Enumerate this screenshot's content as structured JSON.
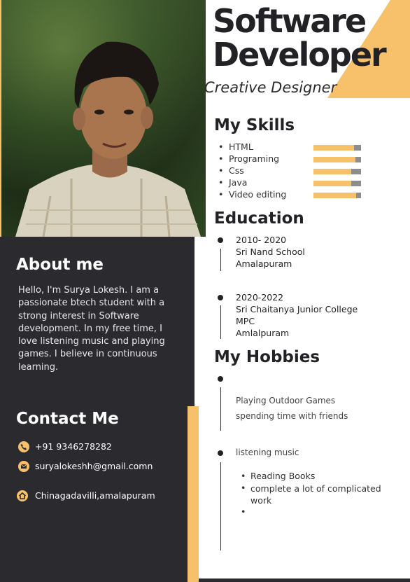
{
  "header": {
    "title_line1": "Software",
    "title_line2": "Developer",
    "subtitle": "Creative Designer"
  },
  "skills": {
    "heading": "My Skills",
    "items": [
      {
        "label": "HTML",
        "level": 0.85
      },
      {
        "label": "Programing",
        "level": 0.88
      },
      {
        "label": "Css",
        "level": 0.8
      },
      {
        "label": "Java",
        "level": 0.8
      },
      {
        "label": "Video editing",
        "level": 0.9
      }
    ]
  },
  "education": {
    "heading": "Education",
    "entries": [
      {
        "years": "2010- 2020",
        "school": "Sri Nand School",
        "extra": "",
        "place": "Amalapuram"
      },
      {
        "years": "2020-2022",
        "school": "Sri Chaitanya Junior College",
        "extra": "MPC",
        "place": "Amlalpuram"
      }
    ]
  },
  "hobbies": {
    "heading": "My Hobbies",
    "line1": "Playing Outdoor Games",
    "line2": "spending time with friends",
    "line3": "listening  music",
    "bullets": [
      "Reading Books",
      "complete a lot of complicated work",
      ""
    ]
  },
  "about": {
    "heading": "About me",
    "text": "Hello, I'm Surya Lokesh. I am a passionate btech student with a strong interest in Software development. In my free time, I love listening music and playing games. I believe in continuous learning."
  },
  "contact": {
    "heading": "Contact Me",
    "phone": "+91 9346278282",
    "email": "suryalokeshh@gmail.comn",
    "address": "Chinagadavilli,amalapuram"
  },
  "colors": {
    "accent": "#f7c16b",
    "dark": "#2b2b2f"
  },
  "icons": [
    "phone-icon",
    "email-icon",
    "home-icon"
  ]
}
